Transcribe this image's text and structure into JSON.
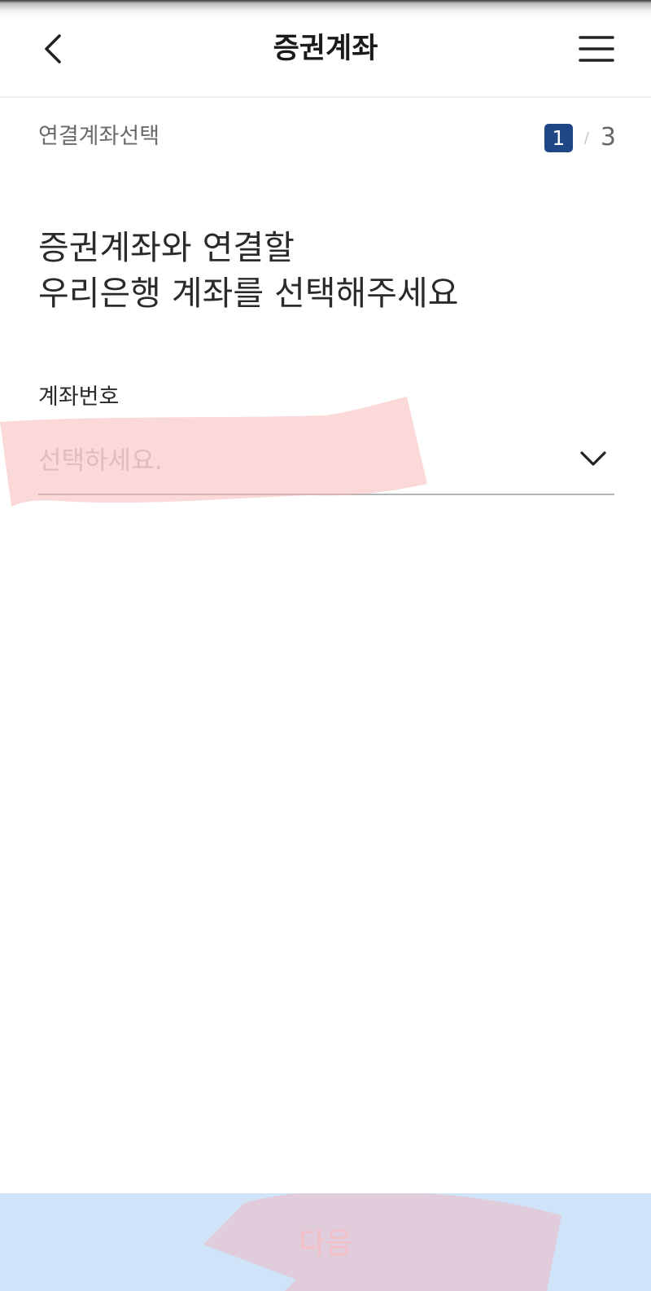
{
  "header": {
    "title": "증권계좌",
    "back_icon": "chevron-left-icon",
    "menu_icon": "hamburger-menu-icon"
  },
  "step": {
    "label": "연결계좌선택",
    "current": "1",
    "separator": "/",
    "total": "3"
  },
  "headline": {
    "line1": "증권계좌와 연결할",
    "line2": "우리은행 계좌를 선택해주세요"
  },
  "account_field": {
    "label": "계좌번호",
    "placeholder": "선택하세요.",
    "dropdown_icon": "chevron-down-icon"
  },
  "footer": {
    "next_label": "다음"
  },
  "colors": {
    "step_badge": "#1f4785",
    "bottom_bar": "#cfe4f8",
    "redaction": "#f8b4b4"
  }
}
